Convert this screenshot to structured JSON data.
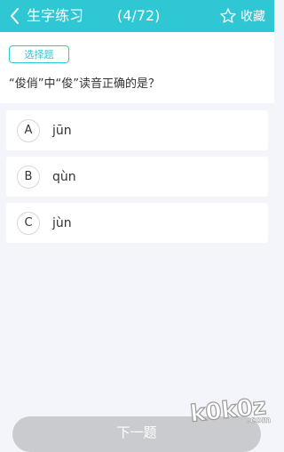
{
  "header": {
    "title": "生字练习",
    "progress": "(4/72)",
    "favorite_label": "收藏"
  },
  "question": {
    "type": "选择题",
    "text": "“俊俏”中“俊”读音正确的是？"
  },
  "options": [
    {
      "letter": "A",
      "text": "jūn"
    },
    {
      "letter": "B",
      "text": "qùn"
    },
    {
      "letter": "C",
      "text": "jùn"
    }
  ],
  "footer": {
    "next_label": "下一题"
  },
  "watermark": {
    "text": "k0k0z.com"
  },
  "colors": {
    "accent": "#2fc7d4",
    "background": "#f3f5fa",
    "button_disabled": "#c9cbce"
  },
  "icons": {
    "back": "chevron-left-icon",
    "favorite": "star-outline-icon"
  }
}
